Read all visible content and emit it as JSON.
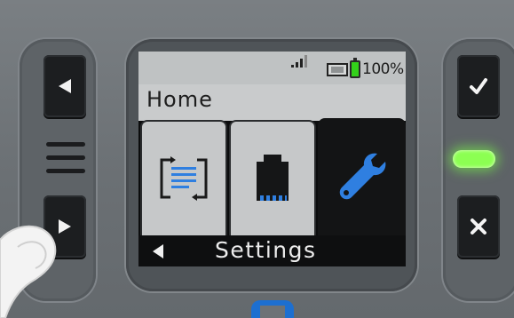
{
  "device": {
    "left_buttons": {
      "up": "left-arrow",
      "down": "right-arrow"
    },
    "right_buttons": {
      "confirm": "checkmark",
      "cancel": "x-mark"
    },
    "led_color": "#8cff52"
  },
  "screen": {
    "status_bar": {
      "battery_percent": "100%",
      "battery_color": "#33d11a"
    },
    "header": {
      "title": "Home"
    },
    "tiles": [
      {
        "icon": "transfer-document-icon",
        "selected": false
      },
      {
        "icon": "ethernet-port-icon",
        "selected": false
      },
      {
        "icon": "wrench-icon",
        "selected": true,
        "accent": "#2f7fe0"
      }
    ],
    "footer": {
      "back_icon": "left-arrow",
      "label": "Settings"
    }
  }
}
